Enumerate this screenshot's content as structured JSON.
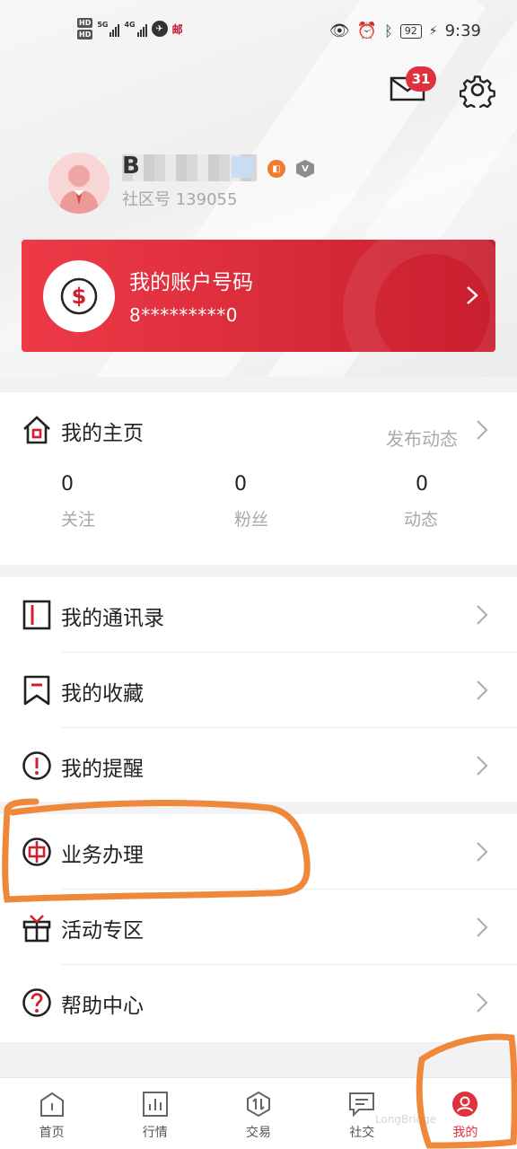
{
  "status_bar": {
    "hd1": "HD",
    "hd2": "HD",
    "sig1": "5G",
    "sig2": "4G",
    "carrier_glyph": "邮",
    "battery": "92",
    "time": "9:39"
  },
  "header": {
    "mail_badge": "31",
    "icons": [
      "mail-icon",
      "gear-icon"
    ]
  },
  "profile": {
    "nickname_visible": "B",
    "community_id": "社区号 139055"
  },
  "account_card": {
    "title": "我的账户号码",
    "number": "8*********0"
  },
  "homepage": {
    "title": "我的主页",
    "publish": "发布动态",
    "stats": [
      {
        "value": "0",
        "label": "关注"
      },
      {
        "value": "0",
        "label": "粉丝"
      },
      {
        "value": "0",
        "label": "动态"
      }
    ]
  },
  "menu1": [
    {
      "label": "我的通讯录",
      "icon": "contacts-book-icon"
    },
    {
      "label": "我的收藏",
      "icon": "bookmark-icon"
    },
    {
      "label": "我的提醒",
      "icon": "alert-icon"
    }
  ],
  "menu2": [
    {
      "label": "业务办理",
      "icon": "business-icon"
    },
    {
      "label": "活动专区",
      "icon": "gift-icon"
    },
    {
      "label": "帮助中心",
      "icon": "help-icon"
    }
  ],
  "bottom_nav": [
    {
      "label": "首页",
      "active": false
    },
    {
      "label": "行情",
      "active": false
    },
    {
      "label": "交易",
      "active": false
    },
    {
      "label": "社交",
      "active": false
    },
    {
      "label": "我的",
      "active": true
    }
  ],
  "watermark": "LongBridge",
  "colors": {
    "brand_red": "#e0323e",
    "annotation_orange": "#f0883c"
  }
}
